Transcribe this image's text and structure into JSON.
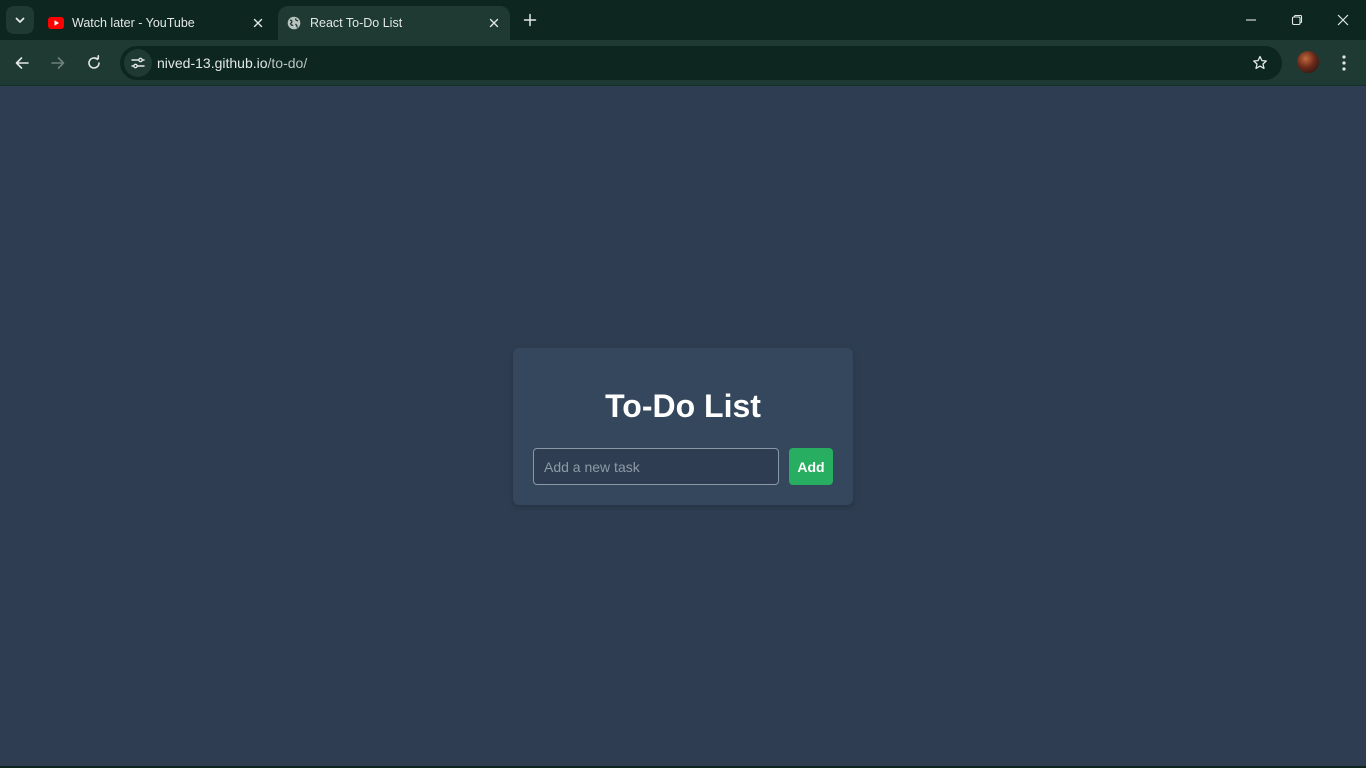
{
  "browser": {
    "tabs": [
      {
        "title": "Watch later - YouTube",
        "favicon": "youtube-icon",
        "active": false
      },
      {
        "title": "React To-Do List",
        "favicon": "globe-icon",
        "active": true
      }
    ],
    "address": {
      "host": "nived-13.github.io",
      "path": "/to-do/"
    }
  },
  "app": {
    "heading": "To-Do List",
    "input_placeholder": "Add a new task",
    "input_value": "",
    "add_label": "Add"
  },
  "colors": {
    "page_background": "#2e3d51",
    "card_background": "#34475c",
    "add_button": "#27ae60",
    "browser_frame": "#0d2620",
    "toolbar": "#1e3a32"
  }
}
